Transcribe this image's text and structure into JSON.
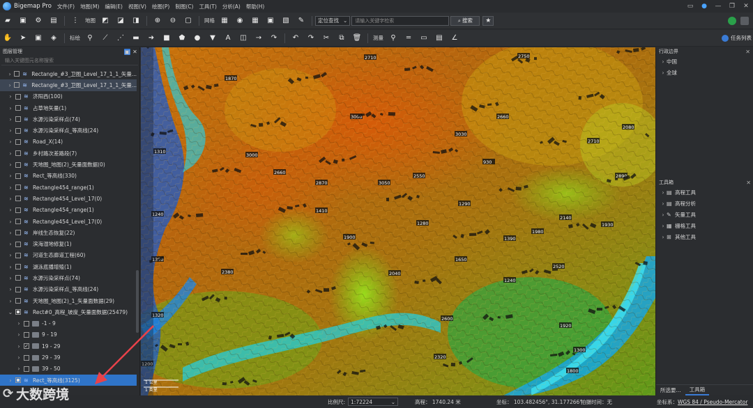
{
  "app": {
    "title": "Bigemap Pro",
    "menu": [
      "文件(F)",
      "地图(M)",
      "编辑(E)",
      "视图(V)",
      "绘图(P)",
      "制图(C)",
      "工具(T)",
      "分析(A)",
      "帮助(H)"
    ]
  },
  "toolbar1": {
    "map_label": "地图",
    "grid_label": "网格",
    "locate_select": "定位查找",
    "search_placeholder": "请输入关键字检索",
    "search_button": "搜索"
  },
  "toolbar2": {
    "annotate_label": "标绘",
    "measure_label": "测量",
    "task_list": "任务列表"
  },
  "layer_panel": {
    "title": "图层管理",
    "search_placeholder": "输入关键图元名称搜索",
    "items": [
      {
        "label": "Rectangle_#3_卫图_Level_17_1_1_矢量...",
        "level": 1,
        "expand": "›",
        "checked": false,
        "selected": false
      },
      {
        "label": "Rectangle_#3_卫图_Level_17_1_1_矢量...",
        "level": 1,
        "expand": "›",
        "checked": false,
        "selected": true
      },
      {
        "label": "济阳西(100)",
        "level": 1,
        "expand": "›",
        "checked": false,
        "selected": false
      },
      {
        "label": "占草地矢量(1)",
        "level": 1,
        "expand": "›",
        "checked": false,
        "selected": false
      },
      {
        "label": "水源污染采样点(74)",
        "level": 1,
        "expand": "›",
        "checked": false,
        "selected": false
      },
      {
        "label": "水源污染采样点_等高线(24)",
        "level": 1,
        "expand": "›",
        "checked": false,
        "selected": false
      },
      {
        "label": "Road_X(14)",
        "level": 1,
        "expand": "›",
        "checked": false,
        "selected": false
      },
      {
        "label": "乡村路次差路段(7)",
        "level": 1,
        "expand": "›",
        "checked": false,
        "selected": false
      },
      {
        "label": "天地图_地图(2)_矢量面数据(0)",
        "level": 1,
        "expand": "›",
        "checked": false,
        "selected": false
      },
      {
        "label": "Rect_等高线(330)",
        "level": 1,
        "expand": "›",
        "checked": false,
        "selected": false
      },
      {
        "label": "Rectangle454_range(1)",
        "level": 1,
        "expand": "›",
        "checked": false,
        "selected": false
      },
      {
        "label": "Rectangle454_Level_17(0)",
        "level": 1,
        "expand": "›",
        "checked": false,
        "selected": false
      },
      {
        "label": "Rectangle454_range(1)",
        "level": 1,
        "expand": "›",
        "checked": false,
        "selected": false
      },
      {
        "label": "Rectangle454_Level_17(0)",
        "level": 1,
        "expand": "›",
        "checked": false,
        "selected": false
      },
      {
        "label": "岸线生态恢复(22)",
        "level": 1,
        "expand": "›",
        "checked": false,
        "selected": false
      },
      {
        "label": "滨海湿地修复(1)",
        "level": 1,
        "expand": "›",
        "checked": false,
        "selected": false
      },
      {
        "label": "河道生态廊道工程(60)",
        "level": 1,
        "expand": "›",
        "checked": false,
        "selected": false
      },
      {
        "label": "湖泳底播增殖(1)",
        "level": 1,
        "expand": "›",
        "checked": false,
        "selected": false
      },
      {
        "label": "水源污染采样点(74)",
        "level": 1,
        "expand": "›",
        "checked": false,
        "selected": false
      },
      {
        "label": "水源污染采样点_等高线(24)",
        "level": 1,
        "expand": "›",
        "checked": false,
        "selected": false
      },
      {
        "label": "天地图_地图(2)_1_矢量面数据(29)",
        "level": 1,
        "expand": "›",
        "checked": false,
        "selected": false
      },
      {
        "label": "Rect#0_高程_坡度_矢量面数据(25479)",
        "level": 1,
        "expand": "⌄",
        "checked": "partial",
        "selected": false
      },
      {
        "label": "-1 - 9",
        "level": 2,
        "expand": "›",
        "checked": false,
        "selected": false
      },
      {
        "label": "9 - 19",
        "level": 2,
        "expand": "›",
        "checked": false,
        "selected": false
      },
      {
        "label": "19 - 29",
        "level": 2,
        "expand": "›",
        "checked": true,
        "selected": false
      },
      {
        "label": "29 - 39",
        "level": 2,
        "expand": "›",
        "checked": false,
        "selected": false
      },
      {
        "label": "39 - 50",
        "level": 2,
        "expand": "›",
        "checked": false,
        "selected": false
      },
      {
        "label": "Rect_等高线(3125)",
        "level": 1,
        "expand": "›",
        "checked": "partial",
        "selected": false,
        "highlight": true
      }
    ]
  },
  "right_panel": {
    "admin_title": "行政边界",
    "admin_items": [
      "中国",
      "全球"
    ],
    "tools_title": "工具箱",
    "tool_items": [
      {
        "label": "高程工具",
        "icon": "elevation-icon"
      },
      {
        "label": "高程分析",
        "icon": "elevation-analysis-icon"
      },
      {
        "label": "矢量工具",
        "icon": "vector-icon"
      },
      {
        "label": "栅格工具",
        "icon": "raster-icon"
      },
      {
        "label": "其他工具",
        "icon": "other-icon"
      }
    ],
    "tabs": [
      "所选要...",
      "工具箱"
    ]
  },
  "statusbar": {
    "scale_label": "比例尺:",
    "scale_value": "1:72224",
    "elevation": "高程： 1740.24 米",
    "coords": "坐标： 103.482456°, 31.177266°",
    "shot_time": "拍摄时间：无",
    "crs_label": "坐标系：",
    "crs_value": "WGS 84 / Pseudo-Mercator"
  },
  "map_labels": [
    "2710",
    "2750",
    "3000",
    "2660",
    "2870",
    "3050",
    "2550",
    "2710",
    "2890",
    "2080",
    "3030",
    "2140",
    "1980",
    "1650",
    "1240",
    "2600",
    "1320",
    "1240",
    "1310",
    "1390",
    "1300",
    "1930",
    "1920",
    "1800",
    "2320",
    "1390",
    "1200",
    "1410",
    "1280",
    "1290",
    "930",
    "1870",
    "3000",
    "2660",
    "1900",
    "2380",
    "2040",
    "2520"
  ],
  "map_scale_text": "1 公里",
  "map_scale_text2": "1 英里",
  "watermark": "大数跨境",
  "colors": {
    "accent": "#2f74c8",
    "arrow": "#e8424a"
  }
}
